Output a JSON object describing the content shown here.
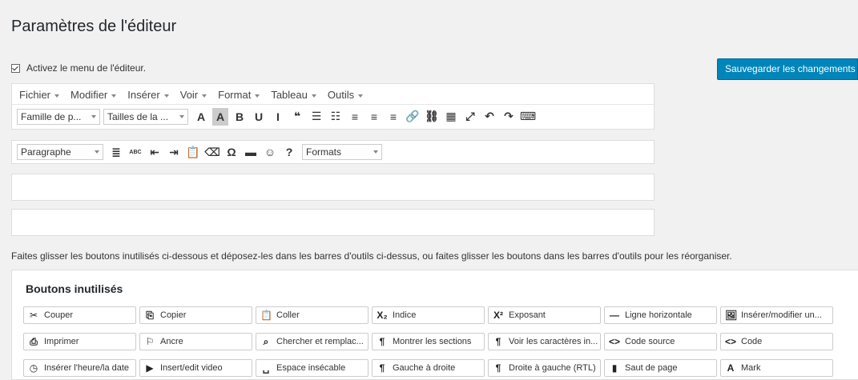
{
  "page_title": "Paramètres de l'éditeur",
  "enable_menu_label": "Activez le menu de l'éditeur.",
  "save_button": "Sauvegarder les changements",
  "menubar": [
    "Fichier",
    "Modifier",
    "Insérer",
    "Voir",
    "Format",
    "Tableau",
    "Outils"
  ],
  "toolbar1": {
    "font_family": "Famille de p...",
    "font_size": "Tailles de la ...",
    "icons": [
      {
        "glyph": "A",
        "name": "text-color-icon"
      },
      {
        "glyph": "A",
        "name": "background-color-icon",
        "active": true
      },
      {
        "glyph": "B",
        "name": "bold-icon"
      },
      {
        "glyph": "U",
        "name": "underline-icon"
      },
      {
        "glyph": "I",
        "name": "italic-icon"
      },
      {
        "glyph": "❝",
        "name": "blockquote-icon"
      },
      {
        "glyph": "☰",
        "name": "bullet-list-icon"
      },
      {
        "glyph": "☷",
        "name": "numbered-list-icon"
      },
      {
        "glyph": "≡",
        "name": "align-left-icon"
      },
      {
        "glyph": "≡",
        "name": "align-center-icon"
      },
      {
        "glyph": "≡",
        "name": "align-right-icon"
      },
      {
        "glyph": "🔗",
        "name": "link-icon"
      },
      {
        "glyph": "⛓",
        "name": "unlink-icon"
      },
      {
        "glyph": "▦",
        "name": "table-icon"
      },
      {
        "glyph": "⤢",
        "name": "fullscreen-icon"
      },
      {
        "glyph": "↶",
        "name": "undo-icon"
      },
      {
        "glyph": "↷",
        "name": "redo-icon"
      },
      {
        "glyph": "⌨",
        "name": "toolbar-toggle-icon"
      }
    ]
  },
  "toolbar2": {
    "format_select": "Paragraphe",
    "formats_select": "Formats",
    "icons": [
      {
        "glyph": "≣",
        "name": "justify-icon"
      },
      {
        "glyph": "ABC",
        "name": "strikethrough-icon"
      },
      {
        "glyph": "⇤",
        "name": "outdent-icon"
      },
      {
        "glyph": "⇥",
        "name": "indent-icon"
      },
      {
        "glyph": "📋",
        "name": "paste-text-icon"
      },
      {
        "glyph": "⌫",
        "name": "clear-formatting-icon"
      },
      {
        "glyph": "Ω",
        "name": "special-character-icon"
      },
      {
        "glyph": "▬",
        "name": "read-more-icon"
      },
      {
        "glyph": "☺",
        "name": "emoticons-icon"
      },
      {
        "glyph": "?",
        "name": "help-icon"
      }
    ]
  },
  "help_text": "Faites glisser les boutons inutilisés ci-dessous et déposez-les dans les barres d'outils ci-dessus, ou faites glisser les boutons dans les barres d'outils pour les réorganiser.",
  "unused_title": "Boutons inutilisés",
  "unused_buttons": [
    {
      "label": "Couper",
      "glyph": "✂",
      "name": "cut-icon"
    },
    {
      "label": "Copier",
      "glyph": "⎘",
      "name": "copy-icon"
    },
    {
      "label": "Coller",
      "glyph": "📋",
      "name": "paste-icon"
    },
    {
      "label": "Indice",
      "glyph": "X₂",
      "name": "subscript-icon"
    },
    {
      "label": "Exposant",
      "glyph": "X²",
      "name": "superscript-icon"
    },
    {
      "label": "Ligne horizontale",
      "glyph": "—",
      "name": "horizontal-line-icon"
    },
    {
      "label": "Insérer/modifier un...",
      "glyph": "🖼",
      "name": "image-icon"
    },
    {
      "label": "Imprimer",
      "glyph": "⎙",
      "name": "print-icon"
    },
    {
      "label": "Ancre",
      "glyph": "⚐",
      "name": "anchor-icon"
    },
    {
      "label": "Chercher et remplac...",
      "glyph": "⌕",
      "name": "search-replace-icon"
    },
    {
      "label": "Montrer les sections",
      "glyph": "¶",
      "name": "show-blocks-icon"
    },
    {
      "label": "Voir les caractères in...",
      "glyph": "¶",
      "name": "invisible-chars-icon"
    },
    {
      "label": "Code source",
      "glyph": "<>",
      "name": "source-code-icon"
    },
    {
      "label": "Code",
      "glyph": "<>",
      "name": "code-icon"
    },
    {
      "label": "Insérer l'heure/la date",
      "glyph": "◷",
      "name": "datetime-icon"
    },
    {
      "label": "Insert/edit video",
      "glyph": "▶",
      "name": "video-icon"
    },
    {
      "label": "Espace insécable",
      "glyph": "␣",
      "name": "nonbreaking-space-icon"
    },
    {
      "label": "Gauche à droite",
      "glyph": "¶",
      "name": "ltr-icon"
    },
    {
      "label": "Droite à gauche (RTL)",
      "glyph": "¶",
      "name": "rtl-icon"
    },
    {
      "label": "Saut de page",
      "glyph": "▮",
      "name": "page-break-icon"
    },
    {
      "label": "Mark",
      "glyph": "A",
      "name": "mark-icon"
    }
  ],
  "colors": {
    "accent": "#0085ba",
    "background": "#f1f1f1"
  }
}
